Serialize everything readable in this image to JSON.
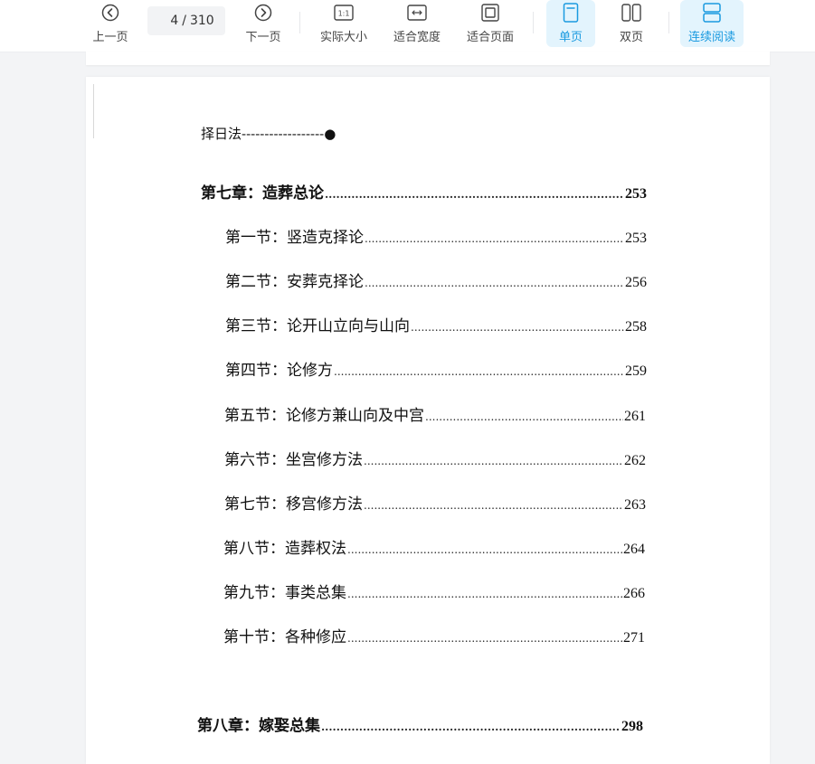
{
  "toolbar": {
    "prev_label": "上一页",
    "next_label": "下一页",
    "current_page": "4",
    "page_separator": "/",
    "total_pages": "310",
    "actual_size_label": "实际大小",
    "fit_width_label": "适合宽度",
    "fit_page_label": "适合页面",
    "single_page_label": "单页",
    "double_page_label": "双页",
    "continuous_label": "连续阅读",
    "actual_size_icon_text": "1:1",
    "accent_color": "#1a9ae0",
    "active_bg": "#e3f4fd",
    "icons": [
      "chevron-left-circle-icon",
      "chevron-right-circle-icon",
      "actual-size-icon",
      "fit-width-icon",
      "fit-page-icon",
      "single-page-icon",
      "double-page-icon",
      "continuous-icon"
    ]
  },
  "document": {
    "top_fragment": "择日法------------------●",
    "chapter7": {
      "title": "第七章：造葬总论",
      "page": "253"
    },
    "sections": [
      {
        "title": "第一节：竖造克择论",
        "page": "253"
      },
      {
        "title": "第二节：安葬克择论",
        "page": "256"
      },
      {
        "title": "第三节：论开山立向与山向",
        "page": "258"
      },
      {
        "title": "第四节：论修方",
        "page": "259"
      },
      {
        "title": "第五节：论修方兼山向及中宫",
        "page": "261"
      },
      {
        "title": "第六节：坐宫修方法",
        "page": "262"
      },
      {
        "title": "第七节：移宫修方法",
        "page": "263"
      },
      {
        "title": "第八节：造葬权法",
        "page": "264"
      },
      {
        "title": "第九节：事类总集",
        "page": "266"
      },
      {
        "title": "第十节：各种修应",
        "page": "271"
      }
    ],
    "chapter8": {
      "title": "第八章：嫁娶总集",
      "page": "298"
    }
  }
}
